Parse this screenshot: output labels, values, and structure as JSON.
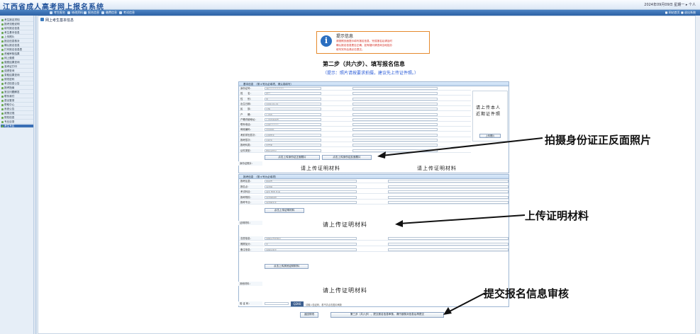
{
  "header": {
    "site_title": "江西省成人高考网上报名系统",
    "right_info": "2024年09月09日 星期一 ▸ 个人"
  },
  "nav": {
    "items": [
      "考生报名",
      "修改资料",
      "报名信息",
      "缴费信息",
      "考试信息"
    ],
    "right": "■ 网站首页 ■ 退出系统"
  },
  "sidebar": {
    "items": [
      "考生报名须知",
      "报考流程说明",
      "填写报名信息",
      "考生基本信息",
      "上传照片",
      "报名信息核对",
      "确认报名信息",
      "打印报名信息表",
      "资格审核结果",
      "网上缴费",
      "缴费结果查询",
      "准考证打印",
      "成绩查询",
      "录取结果查询",
      "修改密码",
      "考试信息公告",
      "报考指南",
      "常见问题解答",
      "联系我们",
      "退出登录",
      "帮助中心",
      "系统公告",
      "政策法规",
      "院校信息",
      "专业目录",
      "考生专区"
    ]
  },
  "breadcrumb": "网上考生基本信息",
  "notice": {
    "title": "提示信息",
    "lines": [
      "请按照页面提示填写报名信息，完成报名后请及时",
      "确认报名信息是否正确，如有疑问请咨询当地招办",
      "填写完毕后请点击提交。"
    ]
  },
  "step": {
    "title": "第二步（共六步）、填写报名信息",
    "tip": "（提示：照片请按要求拍摄，建议先上传证件照。）"
  },
  "section1": {
    "head": "基本信息　（带＊号为必填项，请认真填写）",
    "rows": [
      {
        "label": "身份证号：",
        "value": "36**************"
      },
      {
        "label": "姓　　名：",
        "value": "张**"
      },
      {
        "label": "性　　别：",
        "value": "男"
      },
      {
        "label": "出生日期：",
        "value": "1999-01-01"
      },
      {
        "label": "民　　族：",
        "value": "汉族"
      },
      {
        "label": "户　　籍：",
        "value": "江西省"
      },
      {
        "label": "户籍详细地址：",
        "value": "江西省南昌市"
      },
      {
        "label": "联系电话：",
        "value": "138********"
      },
      {
        "label": "邮政编码：",
        "value": "330000"
      },
      {
        "label": "考前学历层次：",
        "value": "高中毕业"
      },
      {
        "label": "报考层次：",
        "value": "高起专"
      },
      {
        "label": "报考科类：",
        "value": "文史类"
      },
      {
        "label": "证件类型：",
        "value": "居民身份证"
      }
    ],
    "photo_text_line1": "请上传本人",
    "photo_text_line2": "近期证件照",
    "upload_photo_btn": "上传照片",
    "id_upload_front_btn": "点击上传身份证正面照片",
    "id_upload_back_btn": "点击上传身份证反面照片",
    "id_photos_label": "身份证照片：",
    "cert_left": "请上传证明材料",
    "cert_right": "请上传证明材料"
  },
  "section2": {
    "head": "报考信息　（带＊号为必填项）",
    "rows": [
      {
        "label": "报考区县：",
        "value": "南昌市"
      },
      {
        "label": "报名点：",
        "value": "请选择"
      },
      {
        "label": "考试科目：",
        "value": "语文 数学 外语"
      },
      {
        "label": "报考院校：",
        "value": "请选择院校"
      },
      {
        "label": "报考专业：",
        "value": "请选择专业"
      }
    ],
    "upload_proof_btn": "点击上传证明材料",
    "proof_label": "证明材料：",
    "cert_mid": "请上传证明材料",
    "rows2": [
      {
        "label": "志愿信息：",
        "value": "请填写志愿信息"
      },
      {
        "label": "照顾加分：",
        "value": "无"
      },
      {
        "label": "备注信息：",
        "value": "请填写备注"
      }
    ],
    "upload_other_btn": "点击上传其他证明材料",
    "other_label": "其他材料：",
    "cert_bottom": "请上传证明材料",
    "captcha_label": "验 证 码：",
    "captcha_value": "Q2K6",
    "captcha_tip": "请输入验证码，看不清点击图片刷新"
  },
  "buttons": {
    "back": "返回修改",
    "submit": "第三步（共六步）、提交报名信息审核，请仔细核对信息后再提交"
  },
  "callouts": {
    "id_photo": "拍摄身份证正反面照片",
    "proof": "上传证明材料",
    "submit": "提交报名信息审核"
  }
}
